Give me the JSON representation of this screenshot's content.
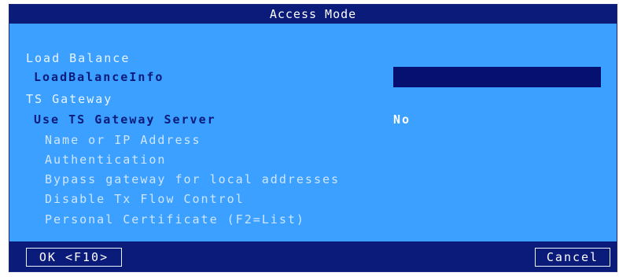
{
  "dialog": {
    "title": "Access Mode",
    "sections": {
      "load_balance": "Load Balance",
      "ts_gateway": "TS Gateway"
    },
    "rows": {
      "load_balance_info": "LoadBalanceInfo",
      "use_ts_gateway_server": "Use TS Gateway Server",
      "name_or_ip": "Name or IP Address",
      "authentication": "Authentication",
      "bypass_gateway": "Bypass gateway for local addresses",
      "disable_tx_flow": "Disable Tx Flow Control",
      "personal_certificate": "Personal Certificate (F2=List)"
    },
    "values": {
      "load_balance_info": "",
      "use_ts_gateway_server": "No"
    },
    "buttons": {
      "ok": "OK <F10>",
      "cancel": "Cancel"
    }
  }
}
